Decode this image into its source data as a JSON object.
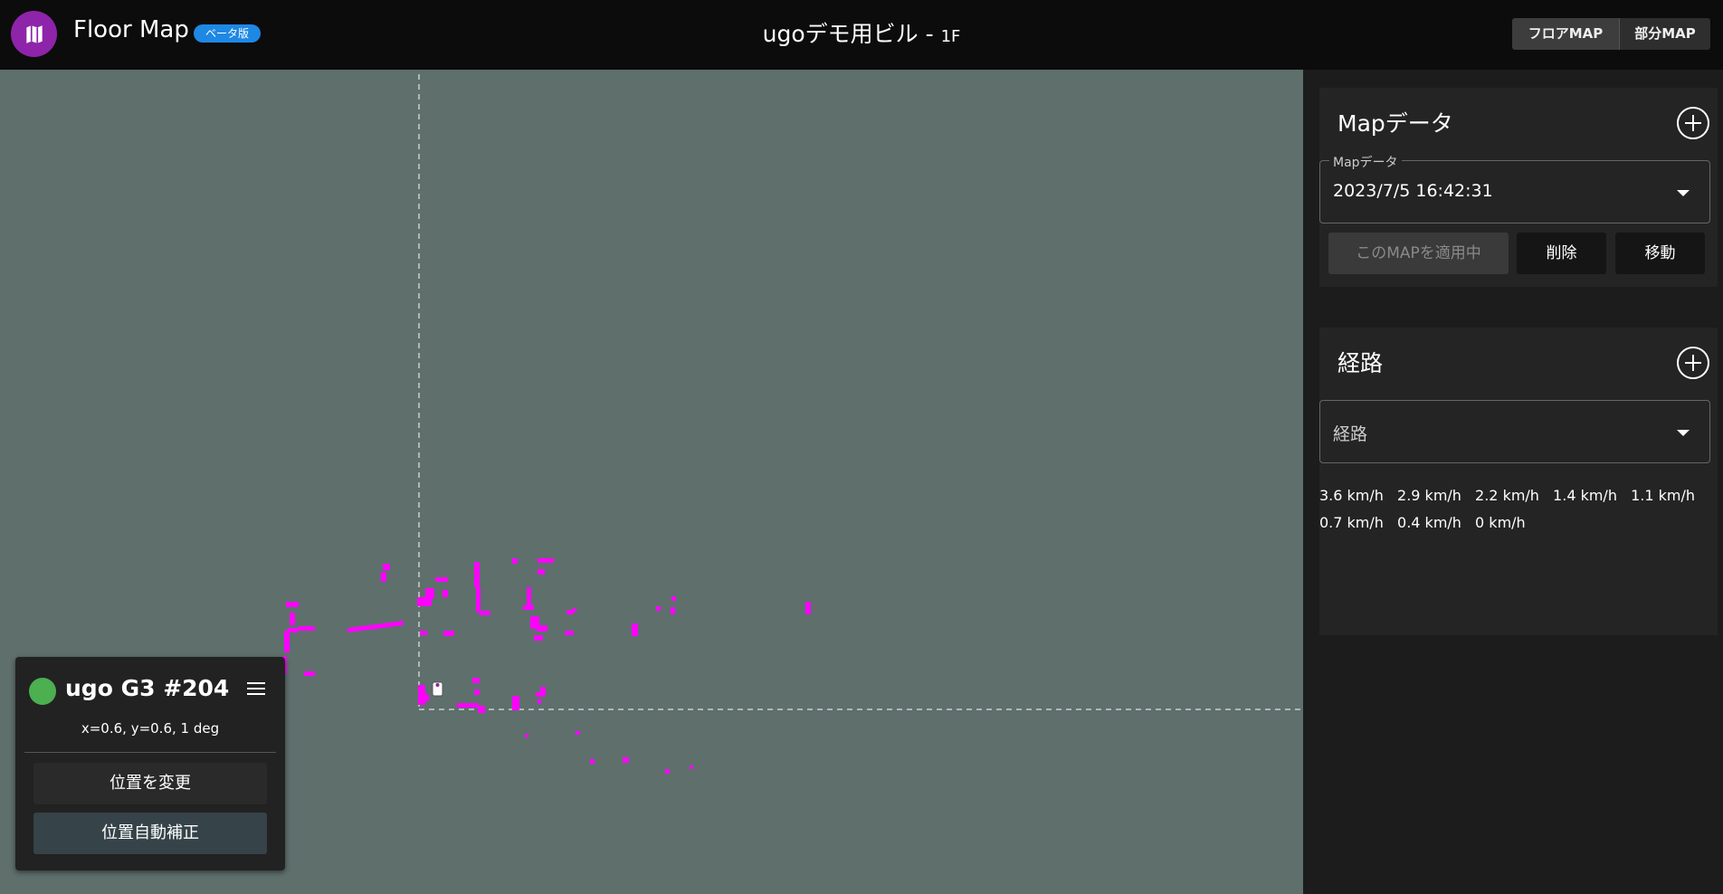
{
  "header": {
    "logo_icon": "map-icon",
    "app_title": "Floor Map",
    "beta_badge": "ベータ版",
    "building_name": "ugoデモ用ビル - ",
    "floor": "1F",
    "view_toggle": [
      "フロアMAP",
      "部分MAP"
    ],
    "active_view": "フロアMAP"
  },
  "map": {
    "background_color": "#5e6f6c",
    "obstacle_color": "#ff00ff"
  },
  "robot_card": {
    "status_color": "#4caf50",
    "name": "ugo G3 #204",
    "menu_icon": "hamburger-menu-icon",
    "pose": "x=0.6, y=0.6, 1 deg",
    "change_position_button": "位置を変更",
    "auto_correct_button": "位置自動補正"
  },
  "map_data_section": {
    "title": "Mapデータ",
    "add_icon": "plus-circle-icon",
    "select_label": "Mapデータ",
    "selected_value": "2023/7/5 16:42:31",
    "apply_button": "このMAPを適用中",
    "delete_button": "削除",
    "move_button": "移動"
  },
  "route_section": {
    "title": "経路",
    "add_icon": "plus-circle-icon",
    "select_placeholder": "経路"
  },
  "speed_legend": [
    {
      "color": "#f8a5a5",
      "label": "3.6 km/h"
    },
    {
      "color": "#f3a8f3",
      "label": "2.9 km/h"
    },
    {
      "color": "#a7a7f3",
      "label": "2.2 km/h"
    },
    {
      "color": "#a4f3f3",
      "label": "1.4 km/h"
    },
    {
      "color": "#a4f0a4",
      "label": "1.1 km/h"
    },
    {
      "color": "#f5f0a0",
      "label": "0.7 km/h"
    },
    {
      "color": "#f7c8a0",
      "label": "0.4 km/h"
    },
    {
      "color": "#ffffff",
      "label": "0 km/h"
    }
  ]
}
